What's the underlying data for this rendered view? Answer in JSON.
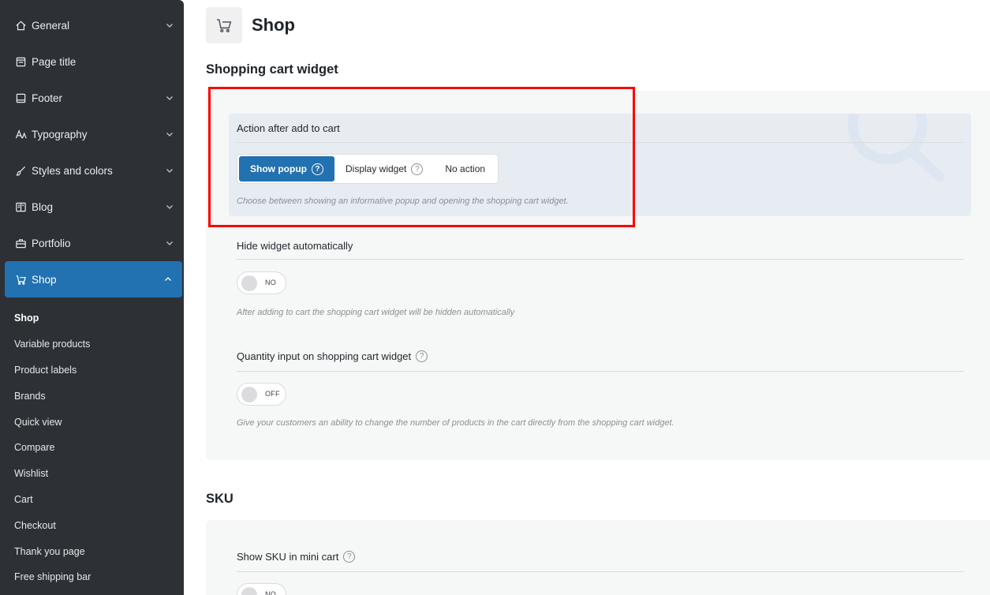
{
  "sidebar": {
    "items": [
      {
        "label": "General",
        "icon": "home-icon",
        "expanded": false
      },
      {
        "label": "Page title",
        "icon": "page-title-icon"
      },
      {
        "label": "Footer",
        "icon": "footer-icon",
        "expanded": false
      },
      {
        "label": "Typography",
        "icon": "typography-icon",
        "expanded": false
      },
      {
        "label": "Styles and colors",
        "icon": "brush-icon",
        "expanded": false
      },
      {
        "label": "Blog",
        "icon": "blog-icon",
        "expanded": false
      },
      {
        "label": "Portfolio",
        "icon": "portfolio-icon",
        "expanded": false
      },
      {
        "label": "Shop",
        "icon": "cart-icon",
        "expanded": true,
        "active": true
      }
    ],
    "sub_items": [
      "Shop",
      "Variable products",
      "Product labels",
      "Brands",
      "Quick view",
      "Compare",
      "Wishlist",
      "Cart",
      "Checkout",
      "Thank you page",
      "Free shipping bar"
    ],
    "active_color": "#2271b1"
  },
  "page": {
    "title": "Shop",
    "icon": "cart-icon"
  },
  "sections": {
    "cart_widget": {
      "title": "Shopping cart widget",
      "action_after_add": {
        "label": "Action after add to cart",
        "options": [
          "Show popup",
          "Display widget",
          "No action"
        ],
        "selected": "Show popup",
        "description": "Choose between showing an informative popup and opening the shopping cart widget."
      },
      "hide_widget": {
        "label": "Hide widget automatically",
        "value": "NO",
        "description": "After adding to cart the shopping cart widget will be hidden automatically"
      },
      "quantity_input": {
        "label": "Quantity input on shopping cart widget",
        "value": "OFF",
        "description": "Give your customers an ability to change the number of products in the cart directly from the shopping cart widget."
      }
    },
    "sku": {
      "title": "SKU",
      "show_sku_mini_cart": {
        "label": "Show SKU in mini cart",
        "value": "NO"
      }
    }
  },
  "help_glyph": "?",
  "highlight_color": "#ff0000"
}
